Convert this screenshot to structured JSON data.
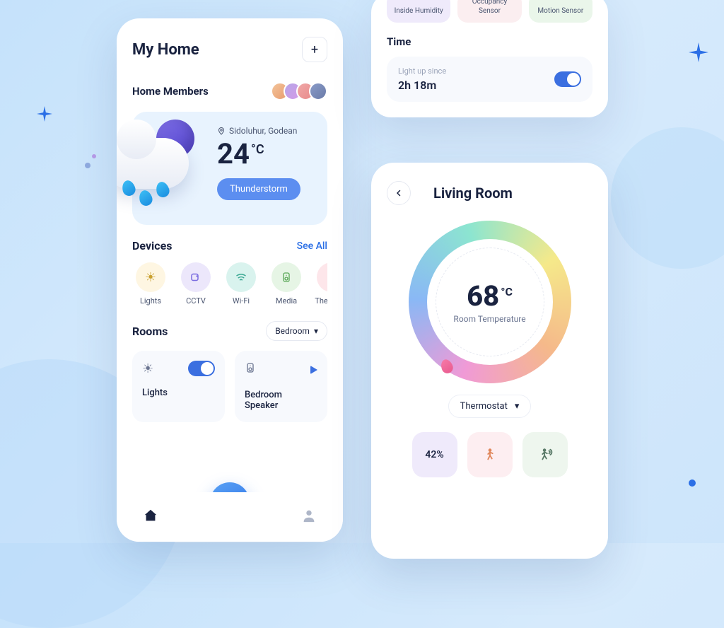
{
  "home": {
    "title": "My Home",
    "members_title": "Home Members",
    "add_icon": "+",
    "weather": {
      "location": "Sidoluhur, Godean",
      "temp": "24",
      "unit": "°C",
      "condition": "Thunderstorm"
    },
    "devices": {
      "title": "Devices",
      "see_all": "See All",
      "items": [
        {
          "label": "Lights"
        },
        {
          "label": "CCTV"
        },
        {
          "label": "Wi-Fi"
        },
        {
          "label": "Media"
        },
        {
          "label": "Thermost"
        }
      ]
    },
    "rooms": {
      "title": "Rooms",
      "selected": "Bedroom",
      "cards": [
        {
          "title": "Lights"
        },
        {
          "title": "Bedroom Speaker"
        }
      ]
    }
  },
  "sensors": {
    "tiles": [
      {
        "label": "Inside Humidity"
      },
      {
        "label": "Occupancy Sensor"
      },
      {
        "label": "Motion Sensor"
      }
    ],
    "time_title": "Time",
    "time_sub": "Light up since",
    "time_value": "2h 18m"
  },
  "room_detail": {
    "title": "Living Room",
    "temp": "68",
    "unit": "°C",
    "temp_label": "Room Temperature",
    "dropdown": "Thermostat",
    "stats": {
      "humidity": "42%"
    }
  }
}
